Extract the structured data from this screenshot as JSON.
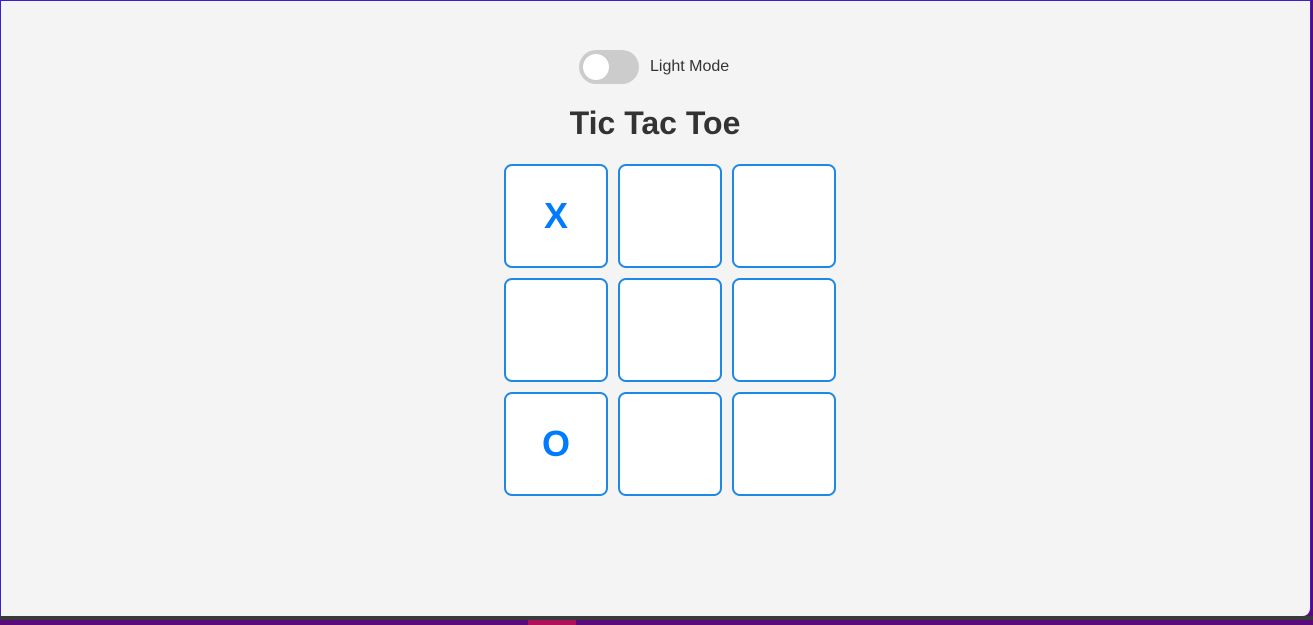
{
  "theme_toggle": {
    "label": "Light Mode",
    "on": false
  },
  "title": "Tic Tac Toe",
  "board": [
    "X",
    "",
    "",
    "",
    "",
    "",
    "O",
    "",
    ""
  ],
  "colors": {
    "accent": "#007bff",
    "cell_border": "#1e88e5",
    "background": "#f4f4f4"
  }
}
